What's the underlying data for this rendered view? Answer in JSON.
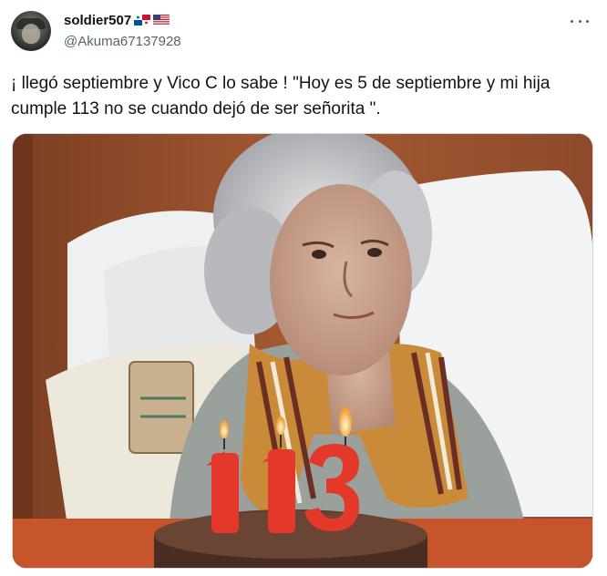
{
  "user": {
    "display_name": "soldier507",
    "handle": "@Akuma67137928",
    "flags": [
      "panama-flag-icon",
      "us-flag-icon"
    ]
  },
  "menu": {
    "icon": "more-horizontal-icon"
  },
  "tweet": {
    "text": "¡ llegó septiembre y Vico C lo sabe ! \"Hoy es 5 de septiembre y mi hija cumple 113 no se cuando dejó de ser señorita \"."
  },
  "media": {
    "candle_digits": [
      "1",
      "1",
      "3"
    ]
  }
}
